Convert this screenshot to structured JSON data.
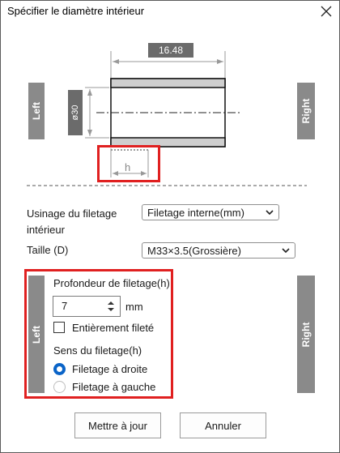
{
  "window": {
    "title": "Spécifier le diamètre intérieur"
  },
  "diagram": {
    "length_value": "16.48",
    "diameter_label": "ø30",
    "depth_label": "h",
    "left_label": "Left",
    "right_label": "Right"
  },
  "form": {
    "machining_label": "Usinage du filetage intérieur",
    "machining_value": "Filetage interne(mm)",
    "size_label": "Taille (D)",
    "size_value": "M33×3.5(Grossière)"
  },
  "thread_panel": {
    "left_label": "Left",
    "right_label": "Right",
    "depth_label": "Profondeur de filetage(h)",
    "depth_value": "7",
    "depth_unit": "mm",
    "full_thread_label": "Entièrement fileté",
    "direction_label": "Sens du filetage(h)",
    "right_hand_label": "Filetage à droite",
    "left_hand_label": "Filetage à gauche",
    "selected_direction": "Filetage à droite"
  },
  "buttons": {
    "update": "Mettre à jour",
    "cancel": "Annuler"
  },
  "colors": {
    "highlight": "#e02020",
    "radio_selected": "#0a64c8",
    "side_button": "#8a8a8a",
    "dimension_tag": "#6b6b6b"
  }
}
